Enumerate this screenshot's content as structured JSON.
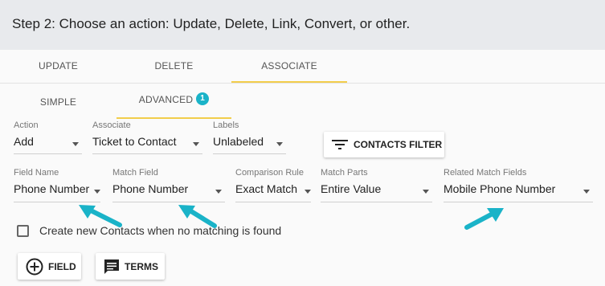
{
  "header": {
    "title": "Step 2: Choose an action: Update, Delete, Link, Convert, or other."
  },
  "action_tabs": [
    {
      "label": "UPDATE"
    },
    {
      "label": "DELETE"
    },
    {
      "label": "ASSOCIATE"
    }
  ],
  "mode_tabs": [
    {
      "label": "SIMPLE"
    },
    {
      "label": "ADVANCED",
      "badge": "1"
    }
  ],
  "row1": {
    "action": {
      "label": "Action",
      "value": "Add"
    },
    "associate": {
      "label": "Associate",
      "value": "Ticket to Contact"
    },
    "labels": {
      "label": "Labels",
      "value": "Unlabeled"
    },
    "contacts_filter_label": "CONTACTS FILTER"
  },
  "row2": {
    "field_name": {
      "label": "Field Name",
      "value": "Phone Number"
    },
    "match_field": {
      "label": "Match Field",
      "value": "Phone Number"
    },
    "comparison_rule": {
      "label": "Comparison Rule",
      "value": "Exact Match"
    },
    "match_parts": {
      "label": "Match Parts",
      "value": "Entire Value"
    },
    "related_match_fields": {
      "label": "Related Match Fields",
      "value": "Mobile Phone Number"
    }
  },
  "create_checkbox_label": "Create new Contacts when no matching is found",
  "buttons": {
    "field_label": "FIELD",
    "terms_label": "TERMS"
  },
  "colors": {
    "accent_underline": "#f2cd4b",
    "badge": "#1ab3c8",
    "arrow": "#1ab3c8"
  },
  "icons": [
    "filter-icon",
    "add-circle-icon",
    "comment-icon",
    "arrow-pointer-icon"
  ]
}
